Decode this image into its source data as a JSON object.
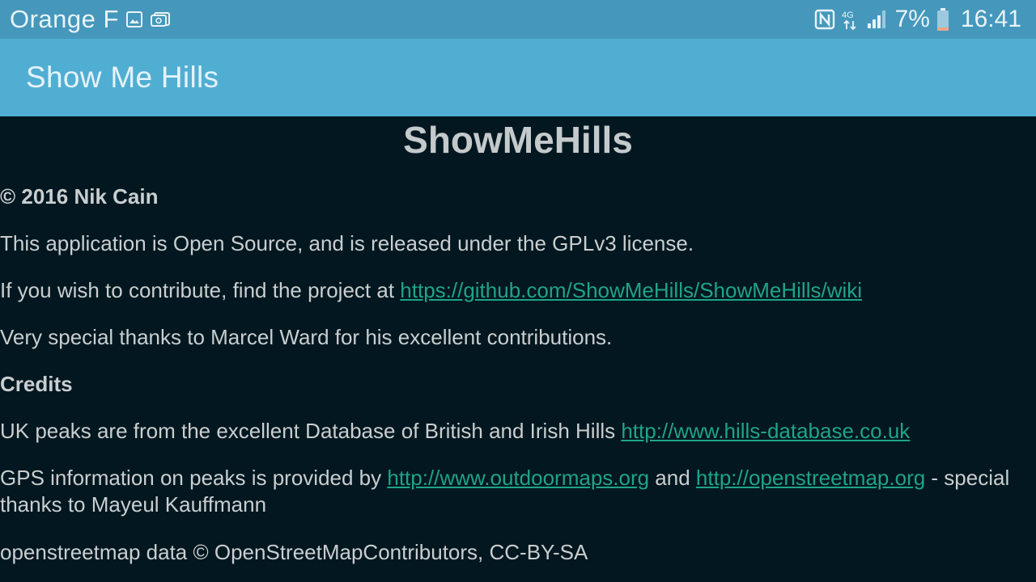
{
  "status_bar": {
    "carrier": "Orange F",
    "network": "4G",
    "battery": "7%",
    "time": "16:41"
  },
  "app_bar": {
    "title": "Show Me Hills"
  },
  "about": {
    "heading": "ShowMeHills",
    "copyright": "© 2016 Nik Cain",
    "license_text": "This application is Open Source, and is released under the GPLv3 license.",
    "contribute_prefix": "If you wish to contribute, find the project at ",
    "contribute_link": "https://github.com/ShowMeHills/ShowMeHills/wiki",
    "thanks_text": "Very special thanks to Marcel Ward for his excellent contributions.",
    "credits_heading": "Credits",
    "uk_peaks_prefix": "UK peaks are from the excellent Database of British and Irish Hills ",
    "uk_peaks_link": "http://www.hills-database.co.uk",
    "gps_prefix": "GPS information on peaks is provided by ",
    "gps_link_1": "http://www.outdoormaps.org",
    "gps_and": " and ",
    "gps_link_2": "http://openstreetmap.org",
    "gps_suffix": " - special thanks to Mayeul Kauffmann",
    "osm_text": "openstreetmap data © OpenStreetMapContributors, CC-BY-SA"
  },
  "colors": {
    "status_bar": "#4598bc",
    "app_bar": "#51aed3",
    "background": "#02171f",
    "link": "#1fa38a"
  }
}
